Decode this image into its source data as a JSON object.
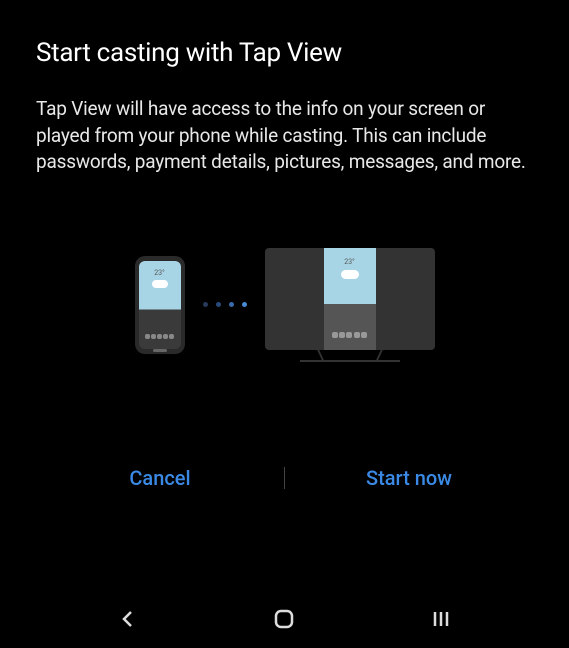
{
  "dialog": {
    "title": "Start casting with Tap View",
    "description": "Tap View will have access to the info on your screen or played from your phone while casting. This can include passwords, payment details, pictures, messages, and more."
  },
  "illustration": {
    "temperature": "23°"
  },
  "buttons": {
    "cancel": "Cancel",
    "confirm": "Start now"
  }
}
